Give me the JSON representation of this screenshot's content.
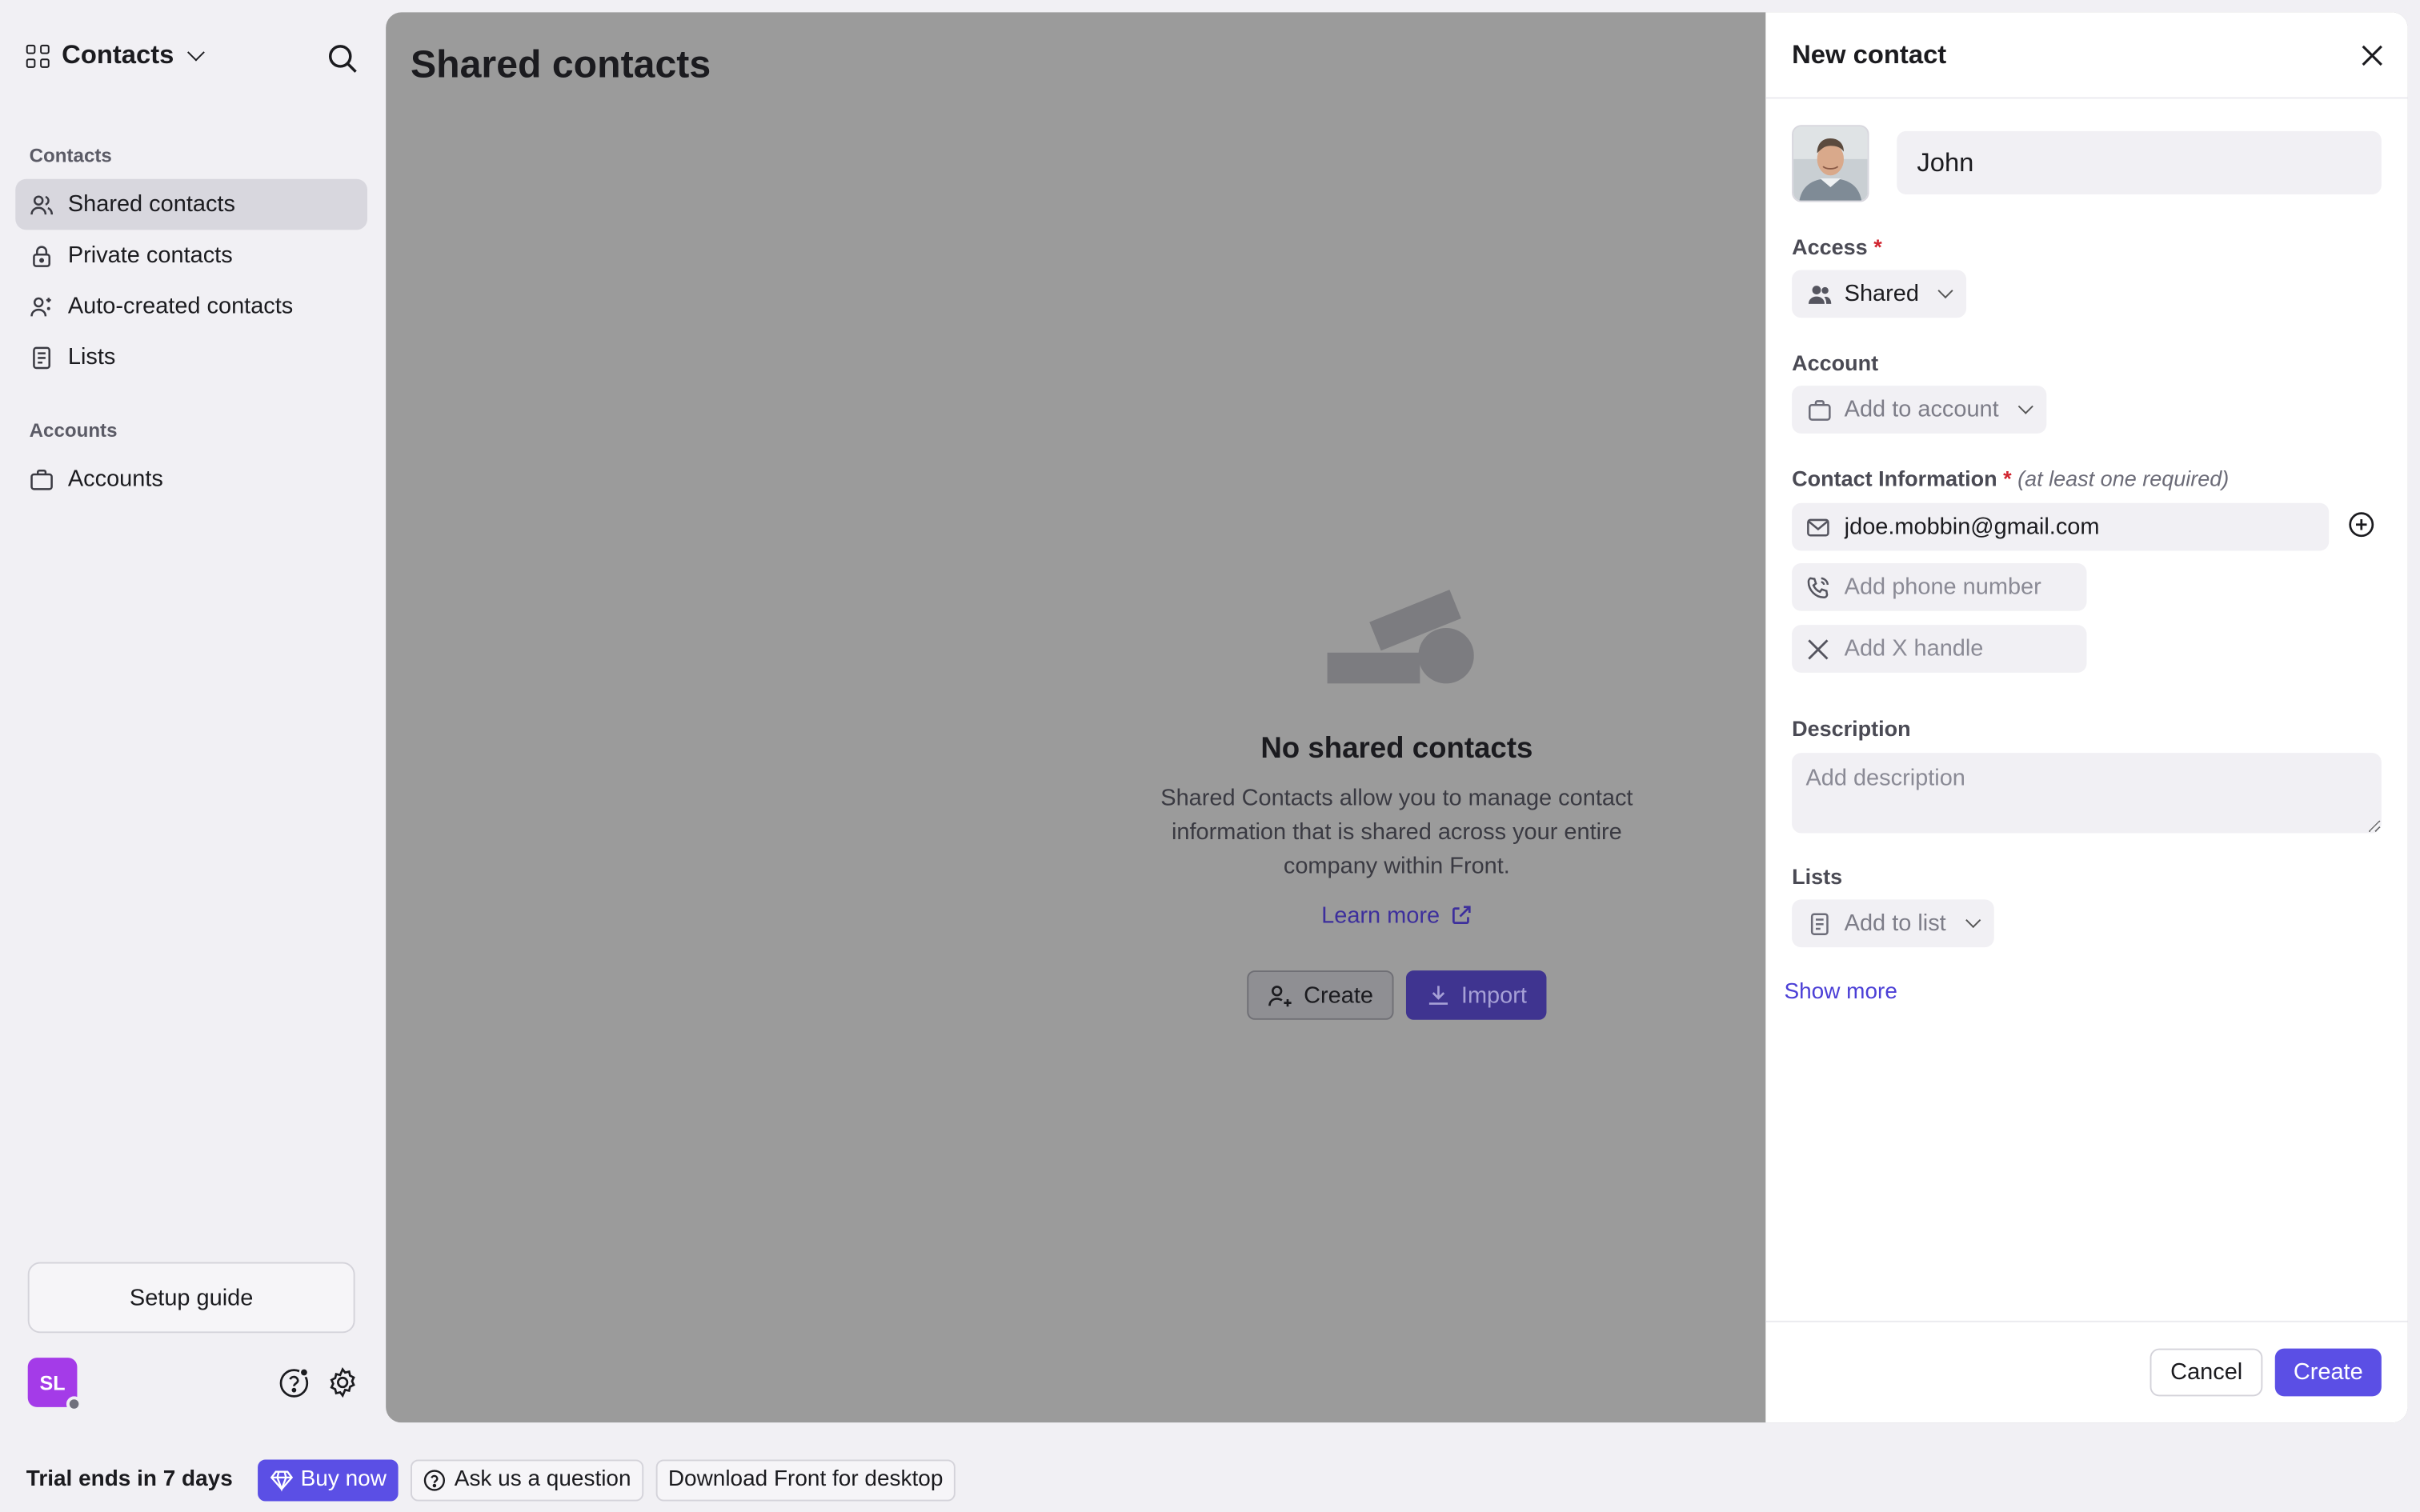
{
  "sidebar": {
    "app_title": "Contacts",
    "sections": [
      {
        "label": "Contacts"
      },
      {
        "label": "Accounts"
      }
    ],
    "items": [
      {
        "label": "Shared contacts",
        "icon": "users-icon",
        "active": true
      },
      {
        "label": "Private contacts",
        "icon": "lock-icon",
        "active": false
      },
      {
        "label": "Auto-created contacts",
        "icon": "user-sparkle-icon",
        "active": false
      },
      {
        "label": "Lists",
        "icon": "list-doc-icon",
        "active": false
      },
      {
        "label": "Accounts",
        "icon": "briefcase-icon",
        "active": false
      }
    ],
    "setup_guide": "Setup guide",
    "avatar_initials": "SL"
  },
  "main": {
    "title": "Shared contacts",
    "empty_title": "No shared contacts",
    "empty_text": "Shared Contacts allow you to manage contact information that is shared across your entire company within Front.",
    "learn_more": "Learn more",
    "create_label": "Create",
    "import_label": "Import"
  },
  "panel": {
    "title": "New contact",
    "name_value": "John",
    "access_label": "Access",
    "access_value": "Shared",
    "account_label": "Account",
    "account_placeholder": "Add to account",
    "contact_info_label": "Contact Information",
    "contact_info_hint": "(at least one required)",
    "email_value": "jdoe.mobbin@gmail.com",
    "phone_placeholder": "Add phone number",
    "x_placeholder": "Add X handle",
    "description_label": "Description",
    "description_placeholder": "Add description",
    "lists_label": "Lists",
    "lists_placeholder": "Add to list",
    "show_more": "Show more",
    "cancel_label": "Cancel",
    "create_label": "Create",
    "required_mark": "*"
  },
  "bottom_bar": {
    "trial_text": "Trial ends in 7 days",
    "buy_now": "Buy now",
    "ask_question": "Ask us a question",
    "download": "Download Front for desktop"
  },
  "colors": {
    "accent": "#5b4fe5",
    "overlay": "#9b9b9b",
    "avatar": "#a43be8",
    "required": "#d1242f"
  }
}
